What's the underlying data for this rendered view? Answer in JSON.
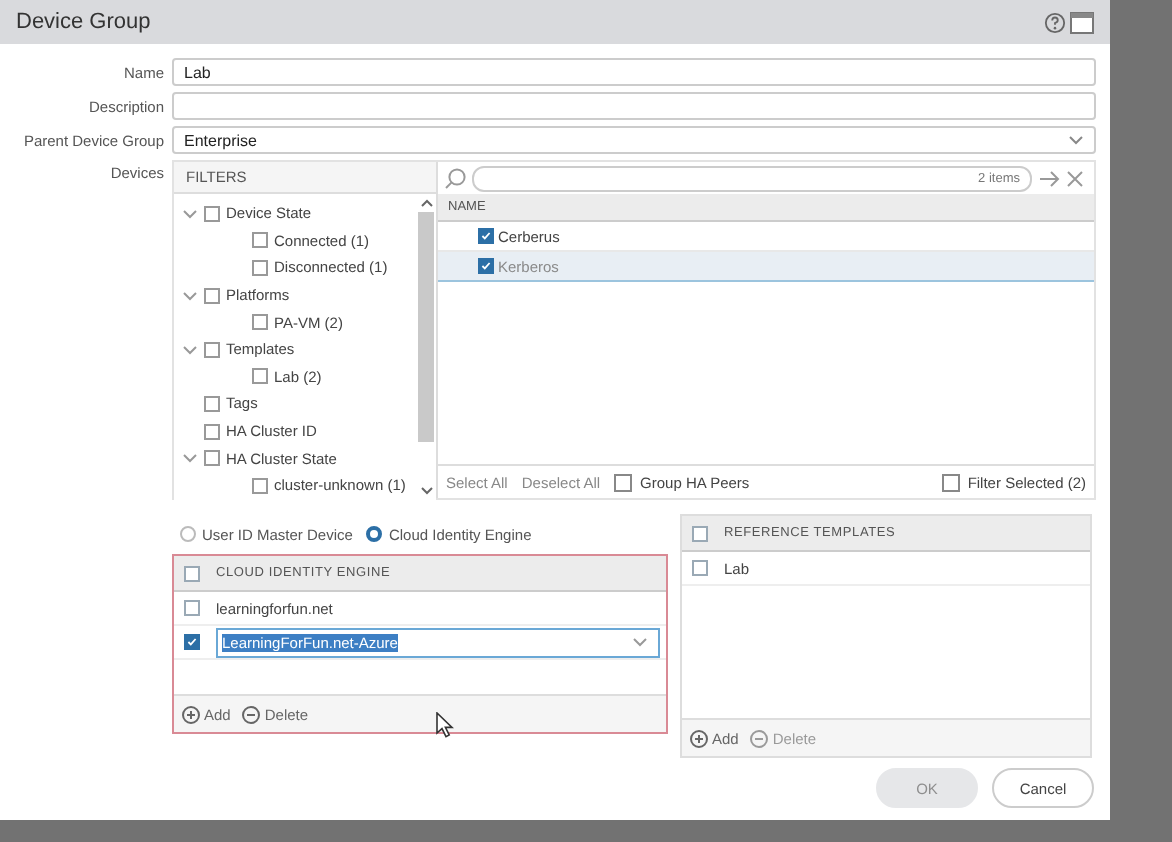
{
  "window": {
    "title": "Device Group"
  },
  "fields": [
    {
      "label": "Name",
      "value": "Lab",
      "kind": "text"
    },
    {
      "label": "Description",
      "kind": "text"
    },
    {
      "label": "Parent Device Group",
      "value": "Enterprise",
      "kind": "select"
    }
  ],
  "devices": {
    "label": "Devices",
    "filters": {
      "title": "FILTERS",
      "items": [
        {
          "label": "Device State",
          "checked": false,
          "expanded": true,
          "children": [
            {
              "label": "Connected (1)",
              "checked": false
            },
            {
              "label": "Disconnected (1)",
              "checked": false
            }
          ]
        },
        {
          "label": "Platforms",
          "checked": false,
          "expanded": true,
          "children": [
            {
              "label": "PA-VM (2)",
              "checked": false
            }
          ]
        },
        {
          "label": "Templates",
          "checked": false,
          "expanded": true,
          "children": [
            {
              "label": "Lab (2)",
              "checked": false
            }
          ]
        },
        {
          "label": "Tags",
          "checked": false
        },
        {
          "label": "HA Cluster ID",
          "checked": false
        },
        {
          "label": "HA Cluster State",
          "checked": false,
          "expanded": true,
          "children": [
            {
              "label": "cluster-unknown (1)",
              "checked": false
            }
          ]
        }
      ]
    },
    "search": {
      "count": "2 items"
    },
    "column": "NAME",
    "rows": [
      {
        "label": "Cerberus",
        "checked": true,
        "disabled": false,
        "selected": false
      },
      {
        "label": "Kerberos",
        "checked": true,
        "disabled": true,
        "selected": true
      }
    ],
    "footer": {
      "select_all": "Select All",
      "deselect_all": "Deselect All",
      "group_ha": {
        "label": "Group HA Peers",
        "checked": false
      },
      "filter_selected": {
        "label": "Filter Selected (2)",
        "checked": false
      }
    }
  },
  "source": [
    {
      "label": "User ID Master Device",
      "selected": false
    },
    {
      "label": "Cloud Identity Engine",
      "selected": true
    }
  ],
  "cie_table": {
    "column": "CLOUD IDENTITY ENGINE",
    "header_checked": false,
    "rows": [
      {
        "kind": "text",
        "value": "learningforfun.net",
        "checked": false
      },
      {
        "kind": "select",
        "value": "LearningForFun.net-Azure",
        "checked": true
      }
    ],
    "add": {
      "label": "Add",
      "disabled": false
    },
    "delete": {
      "label": "Delete",
      "disabled": false
    }
  },
  "ref_table": {
    "column": "REFERENCE TEMPLATES",
    "header_checked": false,
    "rows": [
      {
        "value": "Lab",
        "checked": false
      }
    ],
    "add": {
      "label": "Add",
      "disabled": false
    },
    "delete": {
      "label": "Delete",
      "disabled": true
    }
  },
  "buttons": [
    {
      "label": "OK",
      "disabled": true
    },
    {
      "label": "Cancel",
      "disabled": false
    }
  ]
}
